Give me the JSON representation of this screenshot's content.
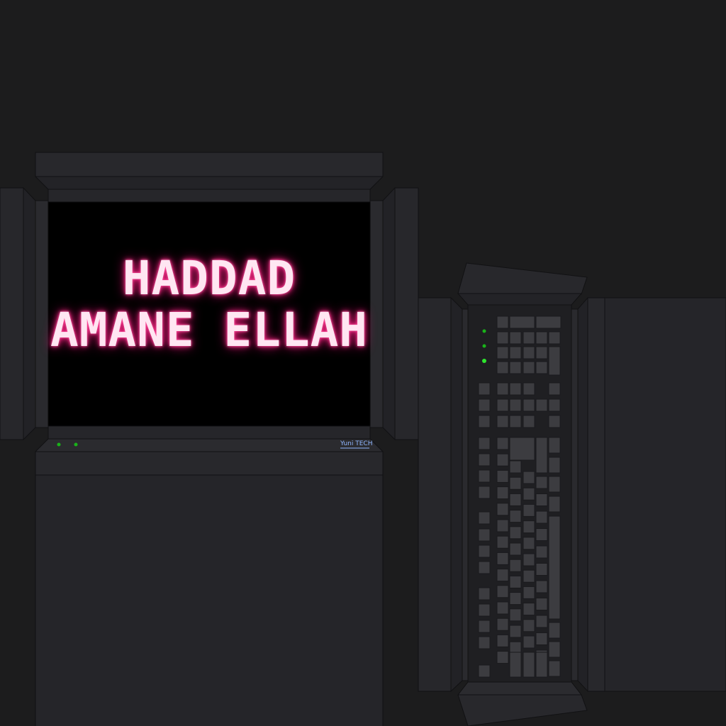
{
  "monitor": {
    "line1": "HADDAD",
    "line2": "AMANE ELLAH",
    "brand": "Yuni TECH"
  },
  "colors": {
    "background": "#1c1c1d",
    "bezel": "#252529",
    "screen": "#000000",
    "glow": "#ff2a86",
    "led": "#19b319",
    "key": "#3c3c40"
  },
  "icons": [
    "power-led",
    "status-led",
    "keyboard-led"
  ]
}
